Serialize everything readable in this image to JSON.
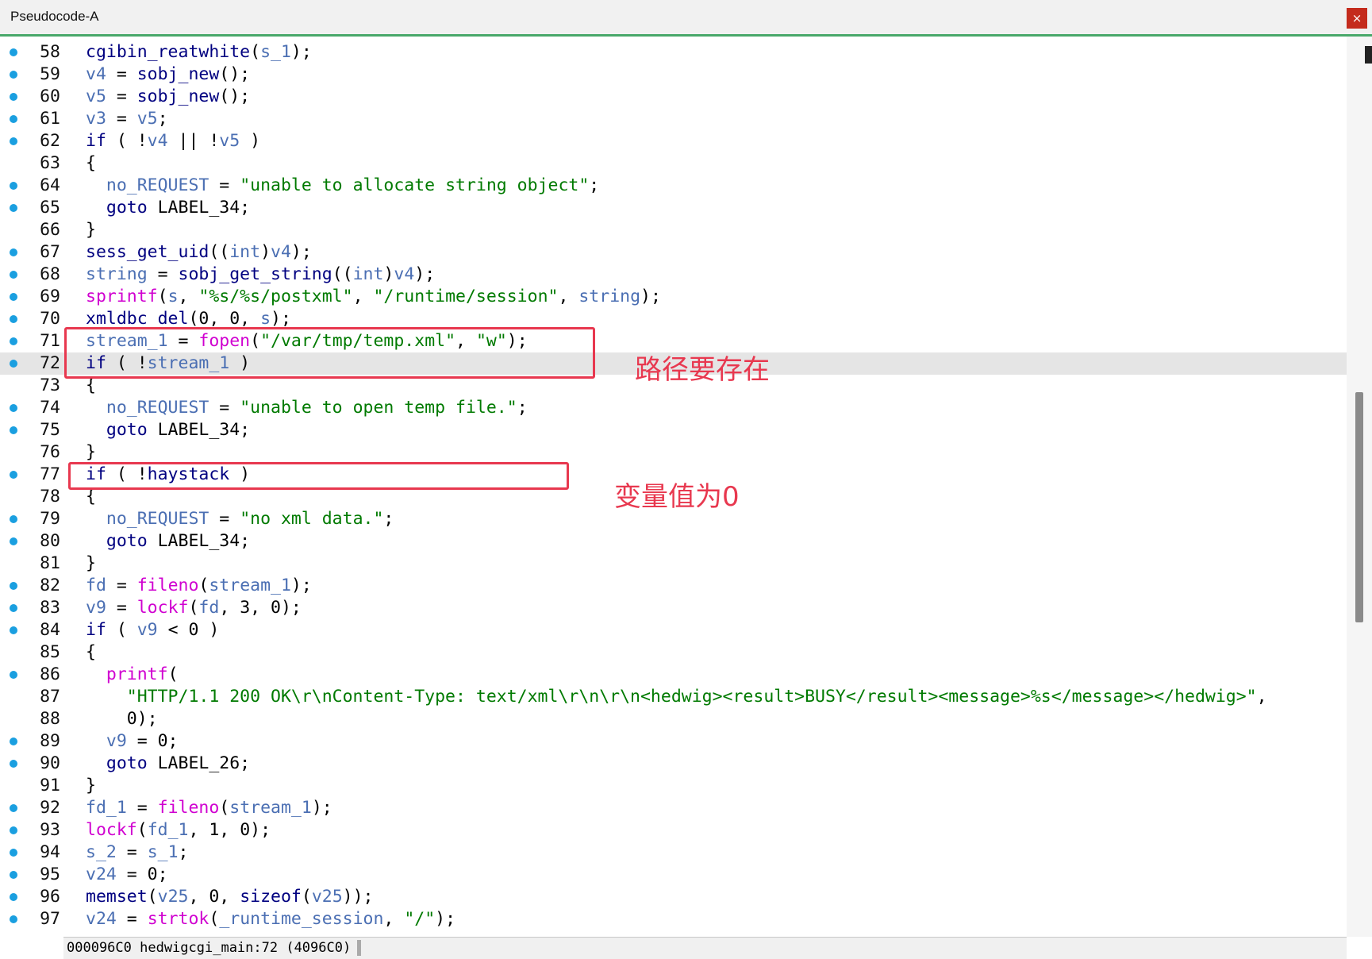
{
  "window": {
    "title": "Pseudocode-A",
    "close_label": "×"
  },
  "code": {
    "lines": [
      {
        "n": "58",
        "dot": true,
        "html": "<span class='f'>cgibin_reatwhite</span>(<span class='v'>s_1</span>);",
        "t": "cgibin_reatwhite(s_1);"
      },
      {
        "n": "59",
        "dot": true,
        "html": "<span class='v'>v4</span> = <span class='f'>sobj_new</span>();",
        "t": "v4 = sobj_new();"
      },
      {
        "n": "60",
        "dot": true,
        "html": "<span class='v'>v5</span> = <span class='f'>sobj_new</span>();",
        "t": "v5 = sobj_new();"
      },
      {
        "n": "61",
        "dot": true,
        "html": "<span class='v'>v3</span> = <span class='v'>v5</span>;",
        "t": "v3 = v5;"
      },
      {
        "n": "62",
        "dot": true,
        "html": "<span class='k'>if</span> ( !<span class='v'>v4</span> || !<span class='v'>v5</span> )",
        "t": "if ( !v4 || !v5 )"
      },
      {
        "n": "63",
        "dot": false,
        "html": "{",
        "t": "{"
      },
      {
        "n": "64",
        "dot": true,
        "html": "  <span class='v'>no_REQUEST</span> = <span class='s'>\"unable to allocate string object\"</span>;",
        "t": "  no_REQUEST = \"unable to allocate string object\";"
      },
      {
        "n": "65",
        "dot": true,
        "html": "  <span class='k'>goto</span> LABEL_34;",
        "t": "  goto LABEL_34;"
      },
      {
        "n": "66",
        "dot": false,
        "html": "}",
        "t": "}"
      },
      {
        "n": "67",
        "dot": true,
        "html": "<span class='f'>sess_get_uid</span>((<span class='v'>int</span>)<span class='v'>v4</span>);",
        "t": "sess_get_uid((int)v4);"
      },
      {
        "n": "68",
        "dot": true,
        "html": "<span class='v'>string</span> = <span class='f'>sobj_get_string</span>((<span class='v'>int</span>)<span class='v'>v4</span>);",
        "t": "string = sobj_get_string((int)v4);"
      },
      {
        "n": "69",
        "dot": true,
        "html": "<span class='lib'>sprintf</span>(<span class='v'>s</span>, <span class='s'>\"%s/%s/postxml\"</span>, <span class='s'>\"/runtime/session\"</span>, <span class='v'>string</span>);",
        "t": "sprintf(s, \"%s/%s/postxml\", \"/runtime/session\", string);"
      },
      {
        "n": "70",
        "dot": true,
        "html": "<span class='f'>xmldbc_del</span>(0, 0, <span class='v'>s</span>);",
        "t": "xmldbc_del(0, 0, s);"
      },
      {
        "n": "71",
        "dot": true,
        "html": "<span class='v'>stream_1</span> = <span class='lib'>fopen</span>(<span class='s'>\"/var/tmp/temp.xml\"</span>, <span class='s'>\"w\"</span>);",
        "t": "stream_1 = fopen(\"/var/tmp/temp.xml\", \"w\");"
      },
      {
        "n": "72",
        "dot": true,
        "hl": true,
        "html": "<span class='k'>if</span> ( !<span class='v'>stream_1</span> )",
        "t": "if ( !stream_1 )"
      },
      {
        "n": "73",
        "dot": false,
        "html": "{",
        "t": "{"
      },
      {
        "n": "74",
        "dot": true,
        "html": "  <span class='v'>no_REQUEST</span> = <span class='s'>\"unable to open temp file.\"</span>;",
        "t": "  no_REQUEST = \"unable to open temp file.\";"
      },
      {
        "n": "75",
        "dot": true,
        "html": "  <span class='k'>goto</span> LABEL_34;",
        "t": "  goto LABEL_34;"
      },
      {
        "n": "76",
        "dot": false,
        "html": "}",
        "t": "}"
      },
      {
        "n": "77",
        "dot": true,
        "html": "<span class='k'>if</span> ( !<span class='f'>haystack</span> )",
        "t": "if ( !haystack )"
      },
      {
        "n": "78",
        "dot": false,
        "html": "{",
        "t": "{"
      },
      {
        "n": "79",
        "dot": true,
        "html": "  <span class='v'>no_REQUEST</span> = <span class='s'>\"no xml data.\"</span>;",
        "t": "  no_REQUEST = \"no xml data.\";"
      },
      {
        "n": "80",
        "dot": true,
        "html": "  <span class='k'>goto</span> LABEL_34;",
        "t": "  goto LABEL_34;"
      },
      {
        "n": "81",
        "dot": false,
        "html": "}",
        "t": "}"
      },
      {
        "n": "82",
        "dot": true,
        "html": "<span class='v'>fd</span> = <span class='lib'>fileno</span>(<span class='v'>stream_1</span>);",
        "t": "fd = fileno(stream_1);"
      },
      {
        "n": "83",
        "dot": true,
        "html": "<span class='v'>v9</span> = <span class='lib'>lockf</span>(<span class='v'>fd</span>, 3, 0);",
        "t": "v9 = lockf(fd, 3, 0);"
      },
      {
        "n": "84",
        "dot": true,
        "html": "<span class='k'>if</span> ( <span class='v'>v9</span> &lt; 0 )",
        "t": "if ( v9 < 0 )"
      },
      {
        "n": "85",
        "dot": false,
        "html": "{",
        "t": "{"
      },
      {
        "n": "86",
        "dot": true,
        "html": "  <span class='lib'>printf</span>(",
        "t": "  printf("
      },
      {
        "n": "87",
        "dot": false,
        "html": "    <span class='s'>\"HTTP/1.1 200 OK\\r\\nContent-Type: text/xml\\r\\n\\r\\n&lt;hedwig&gt;&lt;result&gt;BUSY&lt;/result&gt;&lt;message&gt;%s&lt;/message&gt;&lt;/hedwig&gt;\"</span>,",
        "t": "    \"HTTP/1.1 200 OK\\r\\nContent-Type: text/xml\\r\\n\\r\\n<hedwig><result>BUSY</result><message>%s</message></hedwig>\","
      },
      {
        "n": "88",
        "dot": false,
        "html": "    0);",
        "t": "    0);"
      },
      {
        "n": "89",
        "dot": true,
        "html": "  <span class='v'>v9</span> = 0;",
        "t": "  v9 = 0;"
      },
      {
        "n": "90",
        "dot": true,
        "html": "  <span class='k'>goto</span> LABEL_26;",
        "t": "  goto LABEL_26;"
      },
      {
        "n": "91",
        "dot": false,
        "html": "}",
        "t": "}"
      },
      {
        "n": "92",
        "dot": true,
        "html": "<span class='v'>fd_1</span> = <span class='lib'>fileno</span>(<span class='v'>stream_1</span>);",
        "t": "fd_1 = fileno(stream_1);"
      },
      {
        "n": "93",
        "dot": true,
        "html": "<span class='lib'>lockf</span>(<span class='v'>fd_1</span>, 1, 0);",
        "t": "lockf(fd_1, 1, 0);"
      },
      {
        "n": "94",
        "dot": true,
        "html": "<span class='v'>s_2</span> = <span class='v'>s_1</span>;",
        "t": "s_2 = s_1;"
      },
      {
        "n": "95",
        "dot": true,
        "html": "<span class='v'>v24</span> = 0;",
        "t": "v24 = 0;"
      },
      {
        "n": "96",
        "dot": true,
        "html": "<span class='f'>memset</span>(<span class='v'>v25</span>, 0, <span class='k'>sizeof</span>(<span class='v'>v25</span>));",
        "t": "memset(v25, 0, sizeof(v25));"
      },
      {
        "n": "97",
        "dot": true,
        "html": "<span class='v'>v24</span> = <span class='lib'>strtok</span>(<span class='v'>_runtime_session</span>, <span class='s'>\"/\"</span>);",
        "t": "v24 = strtok(_runtime_session, \"/\");"
      }
    ]
  },
  "status_bar": {
    "text": "000096C0 hedwigcgi_main:72 (4096C0)"
  },
  "annotations": {
    "note1": "路径要存在",
    "note2": "变量值为0",
    "color": "#e8384f"
  }
}
